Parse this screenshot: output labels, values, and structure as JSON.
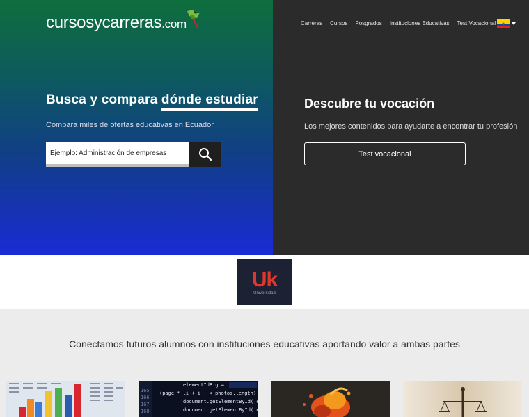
{
  "header": {
    "logo_main": "cursosycarreras",
    "logo_domain": ".com",
    "nav": [
      "Carreras",
      "Cursos",
      "Posgrados",
      "Instituciones Educativas",
      "Test Vocacional"
    ],
    "flag": "ecuador-flag-icon"
  },
  "hero_left": {
    "title_part1": "Busca y compara ",
    "title_part2": "dónde estudiar",
    "subtitle": "Compara miles de ofertas educativas en Ecuador",
    "search_placeholder": "Ejemplo: Administración de empresas",
    "search_icon": "search-icon"
  },
  "hero_right": {
    "title": "Descubre tu vocación",
    "subtitle": "Los mejores contenidos para ayudarte a encontrar tu profesión",
    "button": "Test vocacional"
  },
  "partner": {
    "logo_letters": "Uk",
    "logo_word": "Universidad"
  },
  "tagline": "Conectamos futuros alumnos con instituciones educativas aportando valor a ambas partes",
  "code_card_lines": [
    "elementIdBig = ",
    "(page * li + i - < photos.length) {",
    "document.getElementById( eleme",
    "document.getElementById( eleme"
  ],
  "code_line_numbers": [
    "165",
    "166",
    "167",
    "168"
  ],
  "colors": {
    "gradient_top": "#0f6e3d",
    "gradient_bottom": "#1a2bd6",
    "right_panel": "#2b2b2b",
    "uk_red": "#e0362c"
  }
}
